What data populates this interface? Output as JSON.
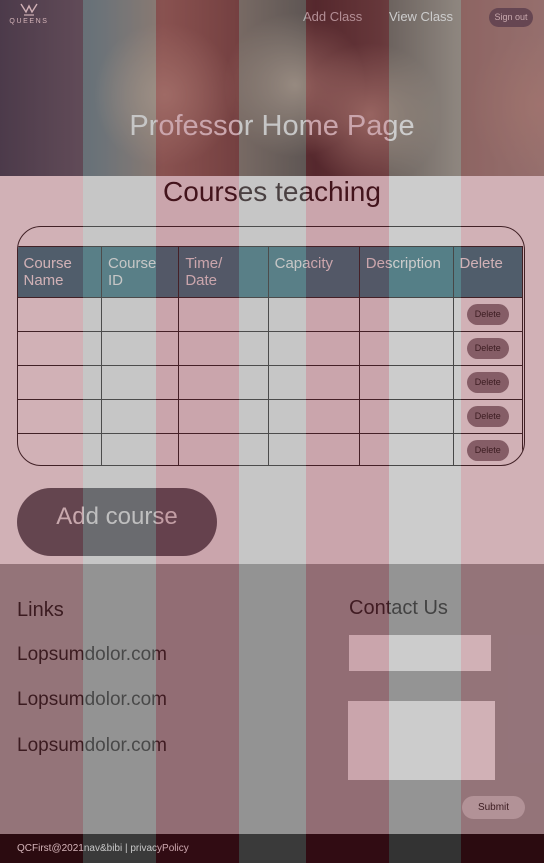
{
  "header": {
    "logo_text": "QUEENS",
    "nav": {
      "add_class": "Add Class",
      "view_class": "View Class"
    },
    "sign_out": "Sign out",
    "hero_title": "Professor Home Page"
  },
  "courses": {
    "title": "Courses teaching",
    "columns": [
      "Course\nName",
      "Course\nID",
      "Time/\nDate",
      "Capacity",
      "Description",
      "Delete"
    ],
    "delete_label": "Delete",
    "row_count": 5
  },
  "add_course_label": "Add course",
  "footer": {
    "links_heading": "Links",
    "links": [
      "Lopsumdolor.com",
      "Lopsumdolor.com",
      "Lopsumdolor.com"
    ],
    "contact_heading": "Contact Us",
    "submit_label": "Submit",
    "copyright": "QCFirst@2021nav&bibi | privacyPolicy"
  },
  "colors": {
    "table_header": "#3a7f8c",
    "footer_bg": "#a2a2a2",
    "stripe_tint": "#7a1f2f",
    "button_dark": "#585962"
  },
  "icons": {
    "logo": "crown-emblem-icon"
  }
}
